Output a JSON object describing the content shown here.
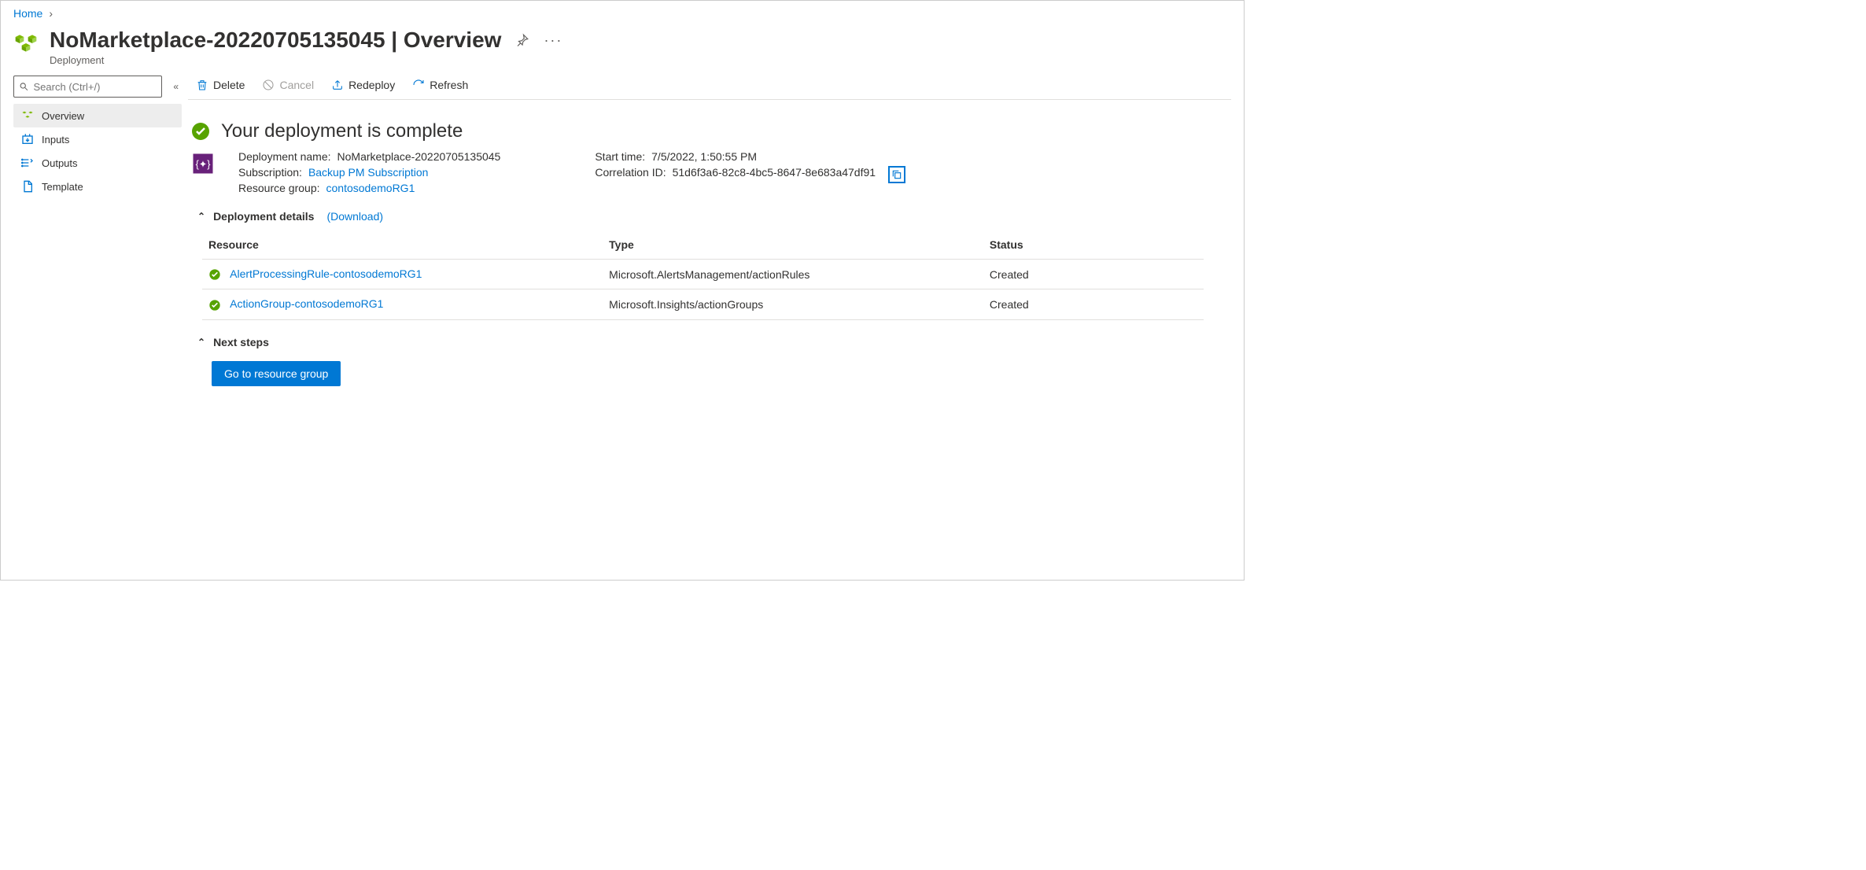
{
  "breadcrumb": {
    "home": "Home"
  },
  "header": {
    "title": "NoMarketplace-20220705135045  |  Overview",
    "subtitle": "Deployment"
  },
  "search": {
    "placeholder": "Search (Ctrl+/)"
  },
  "nav": {
    "overview": "Overview",
    "inputs": "Inputs",
    "outputs": "Outputs",
    "template": "Template"
  },
  "toolbar": {
    "delete": "Delete",
    "cancel": "Cancel",
    "redeploy": "Redeploy",
    "refresh": "Refresh"
  },
  "status": {
    "heading": "Your deployment is complete"
  },
  "details": {
    "deployment_name_label": "Deployment name:",
    "deployment_name": "NoMarketplace-20220705135045",
    "subscription_label": "Subscription:",
    "subscription": "Backup PM Subscription",
    "resource_group_label": "Resource group:",
    "resource_group": "contosodemoRG1",
    "start_time_label": "Start time:",
    "start_time": "7/5/2022, 1:50:55 PM",
    "correlation_label": "Correlation ID:",
    "correlation_id": "51d6f3a6-82c8-4bc5-8647-8e683a47df91"
  },
  "sections": {
    "deployment_details": "Deployment details",
    "download": "(Download)",
    "next_steps": "Next steps"
  },
  "table": {
    "col_resource": "Resource",
    "col_type": "Type",
    "col_status": "Status",
    "rows": [
      {
        "resource": "AlertProcessingRule-contosodemoRG1",
        "type": "Microsoft.AlertsManagement/actionRules",
        "status": "Created"
      },
      {
        "resource": "ActionGroup-contosodemoRG1",
        "type": "Microsoft.Insights/actionGroups",
        "status": "Created"
      }
    ]
  },
  "buttons": {
    "go_rg": "Go to resource group"
  }
}
